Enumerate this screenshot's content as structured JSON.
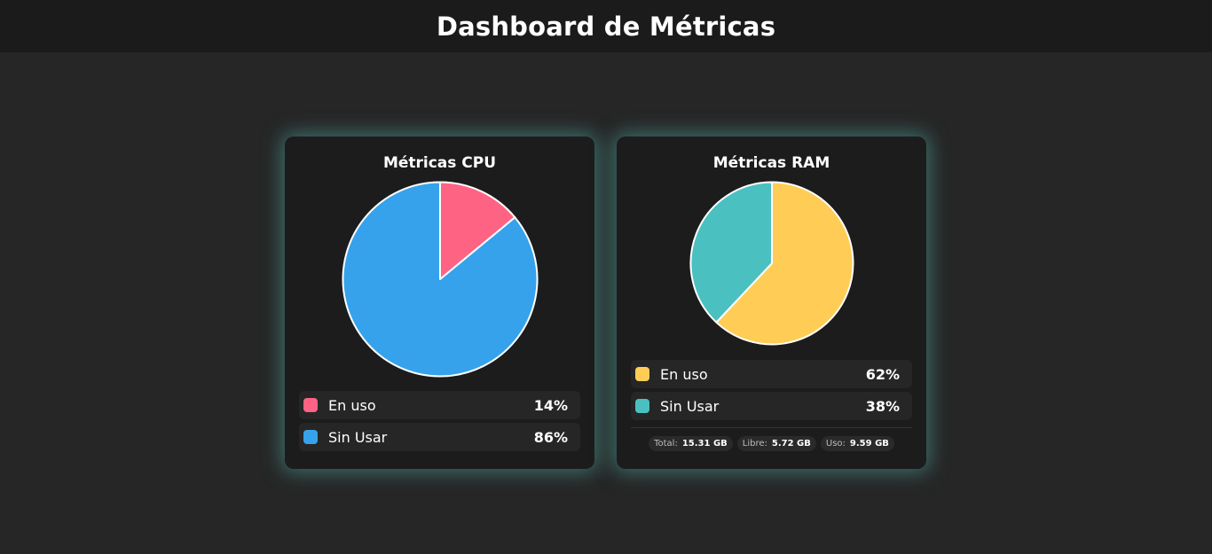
{
  "header": {
    "title": "Dashboard de Métricas"
  },
  "cpu_card": {
    "title": "Métricas CPU",
    "legend": [
      {
        "label": "En uso",
        "value": "14%",
        "color": "#ff6384"
      },
      {
        "label": "Sin Usar",
        "value": "86%",
        "color": "#36a2eb"
      }
    ]
  },
  "ram_card": {
    "title": "Métricas RAM",
    "legend": [
      {
        "label": "En uso",
        "value": "62%",
        "color": "#ffcd56"
      },
      {
        "label": "Sin Usar",
        "value": "38%",
        "color": "#4bc0c0"
      }
    ],
    "stats": [
      {
        "label": "Total:",
        "value": "15.31 GB"
      },
      {
        "label": "Libre:",
        "value": "5.72 GB"
      },
      {
        "label": "Uso:",
        "value": "9.59 GB"
      }
    ]
  },
  "chart_data": [
    {
      "type": "pie",
      "categories": [
        "En uso",
        "Sin Usar"
      ],
      "values": [
        14,
        86
      ],
      "colors": [
        "#ff6384",
        "#36a2eb"
      ],
      "title": "Métricas CPU"
    },
    {
      "type": "pie",
      "categories": [
        "En uso",
        "Sin Usar"
      ],
      "values": [
        62,
        38
      ],
      "colors": [
        "#ffcd56",
        "#4bc0c0"
      ],
      "title": "Métricas RAM"
    }
  ]
}
